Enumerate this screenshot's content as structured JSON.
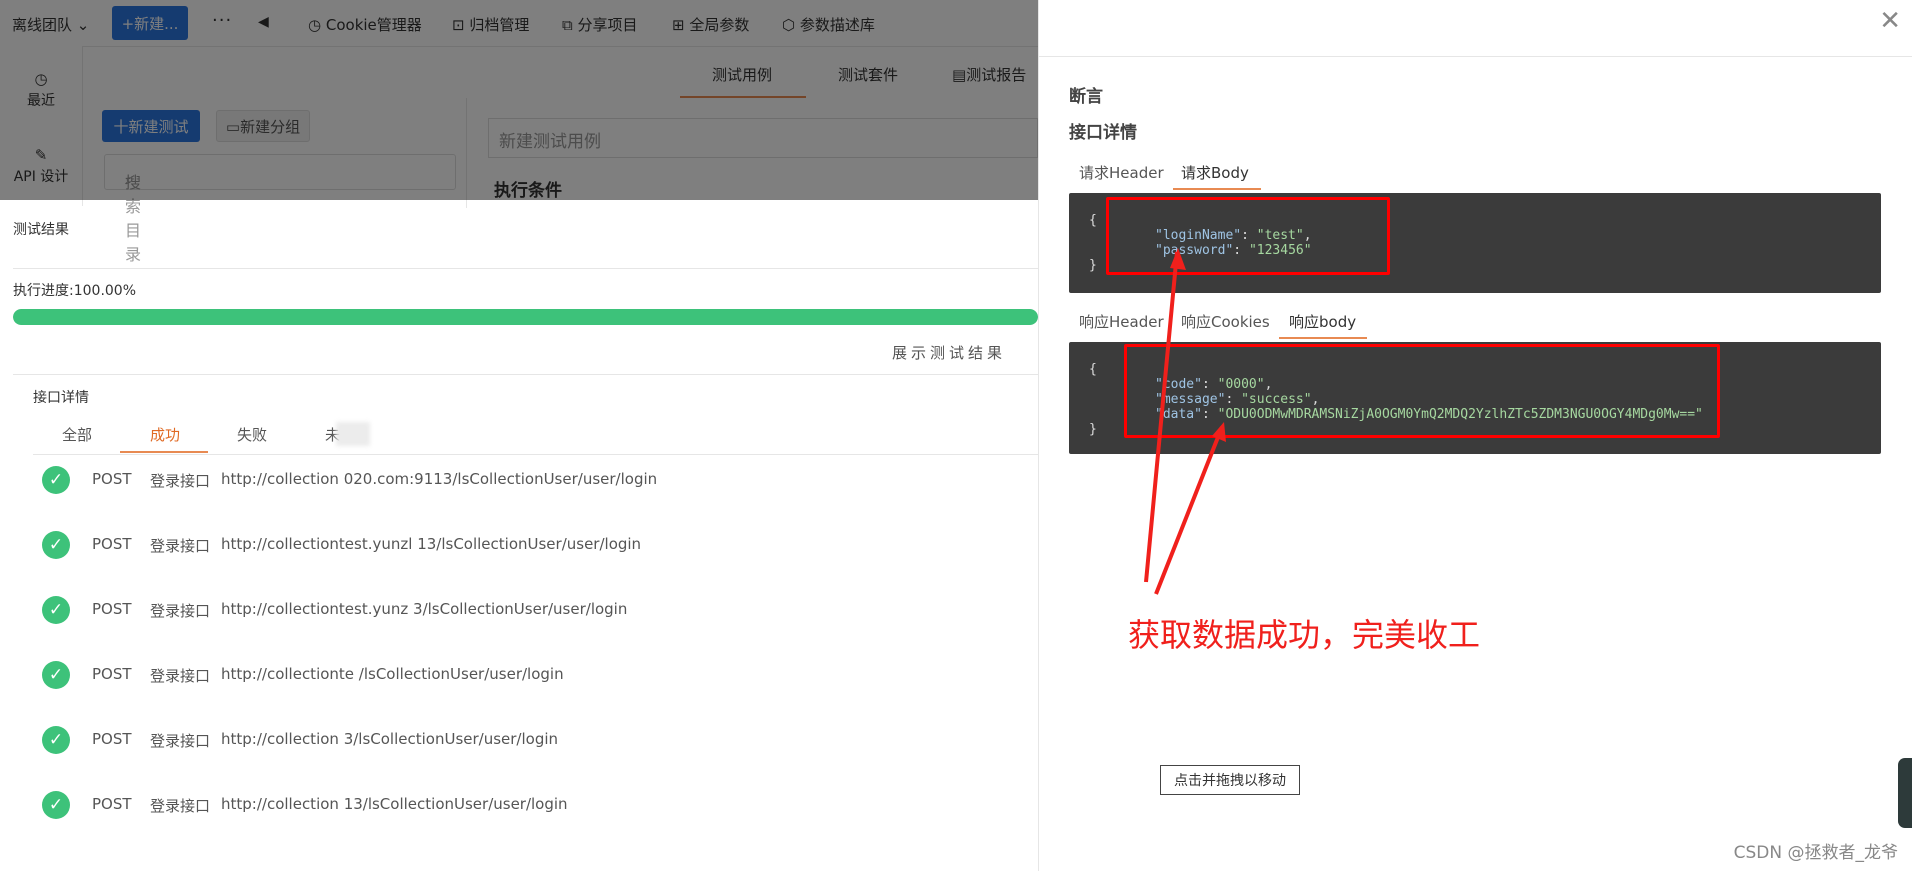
{
  "topbar": {
    "team": "离线团队",
    "new_btn": "+新建...",
    "more": "···",
    "back": "◀",
    "tools": [
      {
        "icon": "cookie-icon",
        "label": "Cookie管理器"
      },
      {
        "icon": "archive-icon",
        "label": "归档管理"
      },
      {
        "icon": "share-icon",
        "label": "分享项目"
      },
      {
        "icon": "globe-icon",
        "label": "全局参数"
      },
      {
        "icon": "cube-icon",
        "label": "参数描述库"
      }
    ]
  },
  "leftnav": {
    "recent": "最近",
    "api_design": "API 设计"
  },
  "subtabs": [
    "测试用例",
    "测试套件",
    "测试报告"
  ],
  "buttons": {
    "new_test": "十新建测试",
    "new_group": "新建分组"
  },
  "search": {
    "placeholder": "搜索目录"
  },
  "case": {
    "placeholder": "新建测试用例",
    "condition": "执行条件"
  },
  "result": {
    "title": "测试结果",
    "progress_label": "执行进度:100.00%",
    "progress": 1.0,
    "show_result": "展示测试结果",
    "api_detail": "接口详情",
    "tabs": [
      "全部",
      "成功",
      "失败",
      "未"
    ],
    "rows": [
      {
        "method": "POST",
        "name": "登录接口",
        "url": "http://collection                020.com:9113/lsCollectionUser/user/login"
      },
      {
        "method": "POST",
        "name": "登录接口",
        "url": "http://collectiontest.yunzl                          13/lsCollectionUser/user/login"
      },
      {
        "method": "POST",
        "name": "登录接口",
        "url": "http://collectiontest.yunz                           3/lsCollectionUser/user/login"
      },
      {
        "method": "POST",
        "name": "登录接口",
        "url": "http://collectionte                                  /lsCollectionUser/user/login"
      },
      {
        "method": "POST",
        "name": "登录接口",
        "url": "http://collection                                  3/lsCollectionUser/user/login"
      },
      {
        "method": "POST",
        "name": "登录接口",
        "url": "http://collection                                13/lsCollectionUser/user/login"
      }
    ]
  },
  "drawer": {
    "assert_title": "断言",
    "detail_title": "接口详情",
    "req_tabs": [
      "请求Header",
      "请求Body"
    ],
    "req_body": {
      "loginName": "test",
      "password": "123456"
    },
    "res_tabs": [
      "响应Header",
      "响应Cookies",
      "响应body"
    ],
    "res_body": {
      "code": "0000",
      "message": "success",
      "data": "ODU0ODMwMDRAMSNiZjA0OGM0YmQ2MDQ2YzlhZTc5ZDM3NGU0OGY4MDg0Mw=="
    },
    "close": "✕"
  },
  "annotation": "获取数据成功，完美收工",
  "drag_btn": "点击并拖拽以移动",
  "watermark": "CSDN @拯救者_龙爷",
  "colors": {
    "accent": "#2b76e0",
    "success": "#3dc27a",
    "tab_active": "#e88a52",
    "annotation": "#f0201c"
  }
}
